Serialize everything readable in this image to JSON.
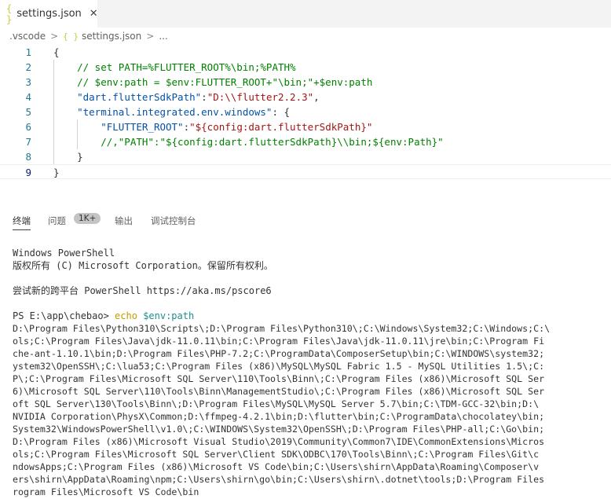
{
  "tab": {
    "icon": "json-braces-icon",
    "icon_glyph": "{ }",
    "label": "settings.json",
    "close": "✕"
  },
  "breadcrumb": {
    "folder": ".vscode",
    "sep1": ">",
    "icon_glyph": "{ }",
    "file": "settings.json",
    "sep2": ">",
    "more": "..."
  },
  "editor": {
    "lines": [
      {
        "n": "1",
        "parts": [
          {
            "t": "{",
            "c": "c-punc"
          }
        ]
      },
      {
        "n": "2",
        "parts": [
          {
            "t": "    // set PATH=%FLUTTER_ROOT%\\bin;%PATH%",
            "c": "c-comment"
          }
        ]
      },
      {
        "n": "3",
        "parts": [
          {
            "t": "    // $env:path = $env:FLUTTER_ROOT+\"\\bin;\"+$env:path",
            "c": "c-comment"
          }
        ]
      },
      {
        "n": "4",
        "parts": [
          {
            "t": "    ",
            "c": "c-punc"
          },
          {
            "t": "\"dart.flutterSdkPath\"",
            "c": "c-key"
          },
          {
            "t": ":",
            "c": "c-punc"
          },
          {
            "t": "\"D:\\\\flutter2.2.3\"",
            "c": "c-str"
          },
          {
            "t": ",",
            "c": "c-punc"
          }
        ]
      },
      {
        "n": "5",
        "parts": [
          {
            "t": "    ",
            "c": "c-punc"
          },
          {
            "t": "\"terminal.integrated.env.windows\"",
            "c": "c-key"
          },
          {
            "t": ": {",
            "c": "c-punc"
          }
        ]
      },
      {
        "n": "6",
        "parts": [
          {
            "t": "        ",
            "c": "c-punc"
          },
          {
            "t": "\"FLUTTER_ROOT\"",
            "c": "c-key"
          },
          {
            "t": ":",
            "c": "c-punc"
          },
          {
            "t": "\"${config:dart.flutterSdkPath}\"",
            "c": "c-str"
          }
        ]
      },
      {
        "n": "7",
        "parts": [
          {
            "t": "        //,\"PATH\":\"${config:dart.flutterSdkPath}\\\\bin;${env:Path}\"",
            "c": "c-comment"
          }
        ]
      },
      {
        "n": "8",
        "parts": [
          {
            "t": "    }",
            "c": "c-punc"
          }
        ]
      },
      {
        "n": "9",
        "parts": [
          {
            "t": "}",
            "c": "c-punc"
          }
        ]
      }
    ]
  },
  "panel": {
    "tabs": [
      {
        "label": "终端",
        "active": true
      },
      {
        "label": "问题",
        "active": false
      },
      {
        "label": "输出",
        "active": false
      },
      {
        "label": "调试控制台",
        "active": false
      }
    ],
    "problems_badge": "1K+"
  },
  "terminal": {
    "header1": "Windows PowerShell",
    "header2": "版权所有 (C) Microsoft Corporation。保留所有权利。",
    "header3": "尝试新的跨平台 PowerShell https://aka.ms/pscore6",
    "prompt": "PS E:\\app\\chebao> ",
    "cmd": "echo",
    "var": "$env:path",
    "output": [
      "D:\\Program Files\\Python310\\Scripts\\;D:\\Program Files\\Python310\\;C:\\Windows\\System32;C:\\Windows;C:\\",
      "ols;C:\\Program Files\\Java\\jdk-11.0.11\\bin;C:\\Program Files\\Java\\jdk-11.0.11\\jre\\bin;C:\\Program Fi",
      "che-ant-1.10.1\\bin;D:\\Program Files\\PHP-7.2;C:\\ProgramData\\ComposerSetup\\bin;C:\\WINDOWS\\system32;",
      "ystem32\\OpenSSH\\;C:\\lua53;C:\\Program Files (x86)\\MySQL\\MySQL Fabric 1.5 - MySQL Utilities 1.5\\;C:",
      "P\\;C:\\Program Files\\Microsoft SQL Server\\110\\Tools\\Binn\\;C:\\Program Files (x86)\\Microsoft SQL Ser",
      "6)\\Microsoft SQL Server\\110\\Tools\\Binn\\ManagementStudio\\;C:\\Program Files (x86)\\Microsoft SQL Ser",
      "oft SQL Server\\130\\Tools\\Binn\\;D:\\Program Files\\MySQL\\MySQL Server 5.7\\bin;C:\\TDM-GCC-32\\bin;D:\\",
      "NVIDIA Corporation\\PhysX\\Common;D:\\ffmpeg-4.2.1\\bin;D:\\flutter\\bin;C:\\ProgramData\\chocolatey\\bin;",
      "System32\\WindowsPowerShell\\v1.0\\;C:\\WINDOWS\\System32\\OpenSSH\\;D:\\Program Files\\PHP-all;C:\\Go\\bin;",
      "D:\\Program Files (x86)\\Microsoft Visual Studio\\2019\\Community\\Common7\\IDE\\CommonExtensions\\Micros",
      "ols;C:\\Program Files\\Microsoft SQL Server\\Client SDK\\ODBC\\170\\Tools\\Binn\\;C:\\Program Files\\Git\\c",
      "ndowsApps;C:\\Program Files (x86)\\Microsoft VS Code\\bin;C:\\Users\\shirn\\AppData\\Roaming\\Composer\\v",
      "ers\\shirn\\AppData\\Roaming\\npm;C:\\Users\\shirn\\go\\bin;C:\\Users\\shirn\\.dotnet\\tools;D:\\Program Files",
      "rogram Files\\Microsoft VS Code\\bin"
    ]
  }
}
